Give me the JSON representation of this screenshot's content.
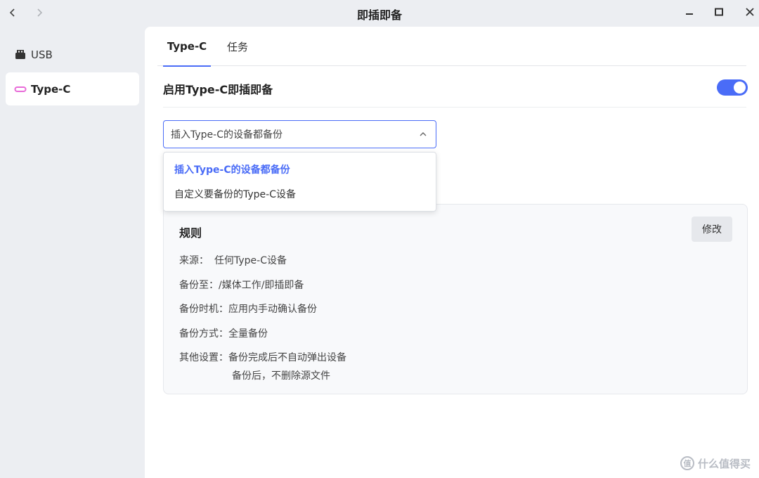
{
  "window": {
    "title": "即插即备"
  },
  "sidebar": {
    "items": [
      {
        "label": "USB",
        "icon": "usb-icon",
        "active": false
      },
      {
        "label": "Type-C",
        "icon": "type-c-icon",
        "active": true
      }
    ]
  },
  "tabs": [
    {
      "label": "Type-C",
      "active": true
    },
    {
      "label": "任务",
      "active": false
    }
  ],
  "settings": {
    "enable_label": "启用Type-C即插即备",
    "enabled": true
  },
  "select": {
    "value": "插入Type-C的设备都备份",
    "options": [
      {
        "label": "插入Type-C的设备都备份",
        "selected": true
      },
      {
        "label": "自定义要备份的Type-C设备",
        "selected": false
      }
    ]
  },
  "rule": {
    "title": "规则",
    "edit_label": "修改",
    "source_key": "来源：",
    "source_value": "任何Type-C设备",
    "dest_key": "备份至：",
    "dest_value": "/媒体工作/即插即备",
    "timing_key": "备份时机：",
    "timing_value": "应用内手动确认备份",
    "mode_key": "备份方式：",
    "mode_value": "全量备份",
    "other_key": "其他设置：",
    "other_values": [
      "备份完成后不自动弹出设备",
      "备份后，不删除源文件"
    ]
  },
  "watermark": {
    "text": "什么值得买"
  },
  "colors": {
    "accent": "#4a6cf7",
    "type_c_icon": "#e86bd8"
  }
}
